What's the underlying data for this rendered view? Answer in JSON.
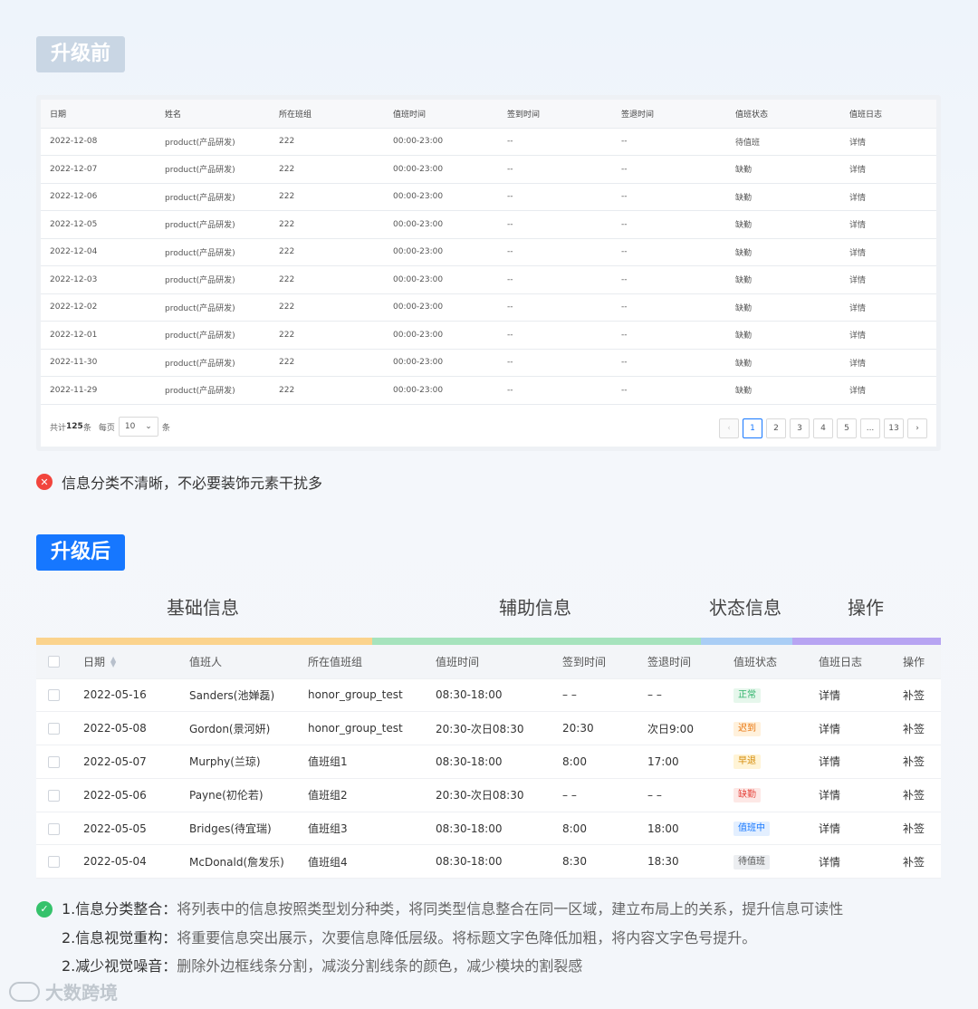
{
  "before": {
    "badge": "升级前",
    "headers": [
      "日期",
      "姓名",
      "所在班组",
      "值班时间",
      "签到时间",
      "签退时间",
      "值班状态",
      "值班日志"
    ],
    "rows": [
      [
        "2022-12-08",
        "product(产品研发)",
        "222",
        "00:00-23:00",
        "--",
        "--",
        "待值班",
        "详情"
      ],
      [
        "2022-12-07",
        "product(产品研发)",
        "222",
        "00:00-23:00",
        "--",
        "--",
        "缺勤",
        "详情"
      ],
      [
        "2022-12-06",
        "product(产品研发)",
        "222",
        "00:00-23:00",
        "--",
        "--",
        "缺勤",
        "详情"
      ],
      [
        "2022-12-05",
        "product(产品研发)",
        "222",
        "00:00-23:00",
        "--",
        "--",
        "缺勤",
        "详情"
      ],
      [
        "2022-12-04",
        "product(产品研发)",
        "222",
        "00:00-23:00",
        "--",
        "--",
        "缺勤",
        "详情"
      ],
      [
        "2022-12-03",
        "product(产品研发)",
        "222",
        "00:00-23:00",
        "--",
        "--",
        "缺勤",
        "详情"
      ],
      [
        "2022-12-02",
        "product(产品研发)",
        "222",
        "00:00-23:00",
        "--",
        "--",
        "缺勤",
        "详情"
      ],
      [
        "2022-12-01",
        "product(产品研发)",
        "222",
        "00:00-23:00",
        "--",
        "--",
        "缺勤",
        "详情"
      ],
      [
        "2022-11-30",
        "product(产品研发)",
        "222",
        "00:00-23:00",
        "--",
        "--",
        "缺勤",
        "详情"
      ],
      [
        "2022-11-29",
        "product(产品研发)",
        "222",
        "00:00-23:00",
        "--",
        "--",
        "缺勤",
        "详情"
      ]
    ],
    "footer": {
      "total_prefix": "共计",
      "total": "125",
      "total_suffix": "条",
      "per_page_label": "每页",
      "page_size": "10",
      "per_page_suffix": "条"
    },
    "pager": [
      "1",
      "2",
      "3",
      "4",
      "5",
      "...",
      "13"
    ],
    "note": "信息分类不清晰，不必要装饰元素干扰多"
  },
  "after": {
    "badge": "升级后",
    "groups": [
      {
        "label": "基础信息",
        "color": "#fbd38d"
      },
      {
        "label": "辅助信息",
        "color": "#a6e3bd"
      },
      {
        "label": "状态信息",
        "color": "#a9cdf5"
      },
      {
        "label": "操作",
        "color": "#b7a4f2"
      }
    ],
    "headers": [
      "日期",
      "值班人",
      "所在值班组",
      "值班时间",
      "签到时间",
      "签退时间",
      "值班状态",
      "值班日志",
      "操作"
    ],
    "rows": [
      {
        "date": "2022-05-16",
        "person": "Sanders(池婵磊)",
        "group": "honor_group_test",
        "time": "08:30-18:00",
        "in": "– –",
        "out": "– –",
        "status": "正常",
        "status_color": "#2fb36a",
        "status_bg": "#e6f7ec",
        "log": "详情",
        "op": "补签"
      },
      {
        "date": "2022-05-08",
        "person": "Gordon(景河妍)",
        "group": "honor_group_test",
        "time": "20:30-次日08:30",
        "in": "20:30",
        "out": "次日9:00",
        "status": "迟到",
        "status_color": "#e8740c",
        "status_bg": "#fff1dc",
        "log": "详情",
        "op": "补签"
      },
      {
        "date": "2022-05-07",
        "person": "Murphy(兰琼)",
        "group": "值班组1",
        "time": "08:30-18:00",
        "in": "8:00",
        "out": "17:00",
        "status": "早退",
        "status_color": "#d48a06",
        "status_bg": "#fff4d6",
        "log": "详情",
        "op": "补签"
      },
      {
        "date": "2022-05-06",
        "person": "Payne(初伦若)",
        "group": "值班组2",
        "time": "20:30-次日08:30",
        "in": "– –",
        "out": "– –",
        "status": "缺勤",
        "status_color": "#e5443c",
        "status_bg": "#fde8e6",
        "log": "详情",
        "op": "补签"
      },
      {
        "date": "2022-05-05",
        "person": "Bridges(待宜瑞)",
        "group": "值班组3",
        "time": "08:30-18:00",
        "in": "8:00",
        "out": "18:00",
        "status": "值班中",
        "status_color": "#1677ff",
        "status_bg": "#e3efff",
        "log": "详情",
        "op": "补签"
      },
      {
        "date": "2022-05-04",
        "person": "McDonald(詹发乐)",
        "group": "值班组4",
        "time": "08:30-18:00",
        "in": "8:30",
        "out": "18:30",
        "status": "待值班",
        "status_color": "#555555",
        "status_bg": "#eceef1",
        "log": "详情",
        "op": "补签"
      }
    ],
    "notes": [
      {
        "label": "1.信息分类整合：",
        "text": "将列表中的信息按照类型划分种类，将同类型信息整合在同一区域，建立布局上的关系，提升信息可读性"
      },
      {
        "label": "2.信息视觉重构：",
        "text": "将重要信息突出展示，次要信息降低层级。将标题文字色降低加粗，将内容文字色号提升。"
      },
      {
        "label": "2.减少视觉噪音：",
        "text": "删除外边框线条分割，减淡分割线条的颜色，减少模块的割裂感"
      }
    ]
  },
  "watermark": "大数跨境"
}
